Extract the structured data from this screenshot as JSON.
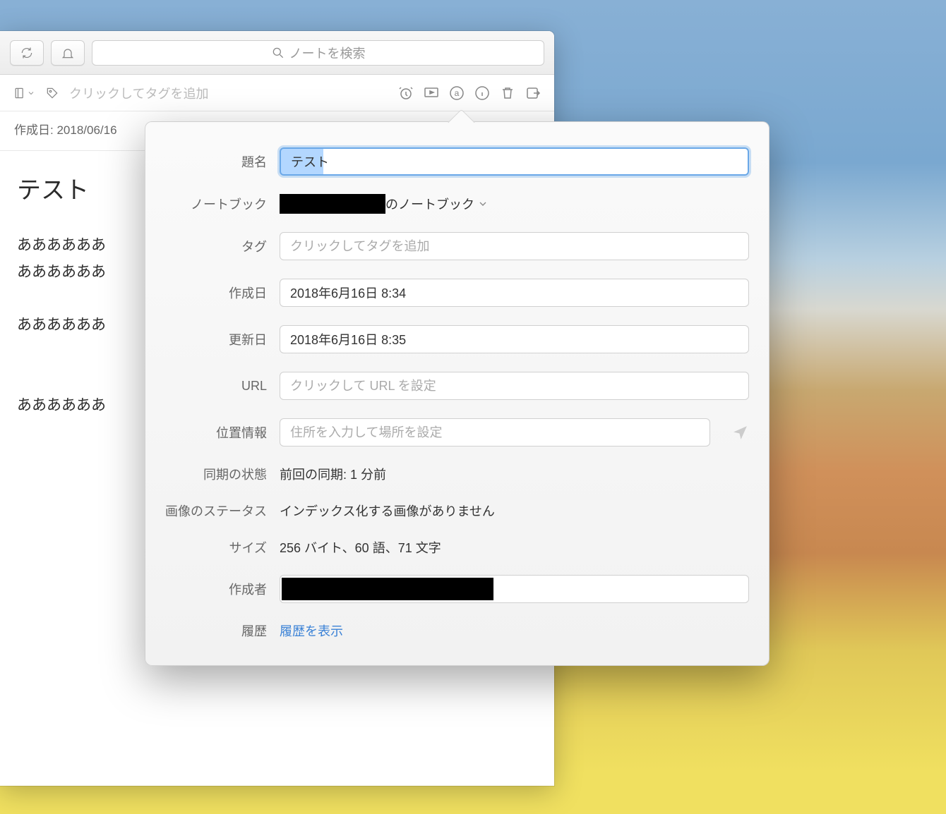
{
  "toolbar": {
    "search_placeholder": "ノートを検索"
  },
  "row2": {
    "tag_placeholder": "クリックしてタグを追加"
  },
  "meta": {
    "created_label": "作成日:",
    "created_value": "2018/06/16"
  },
  "note": {
    "title": "テスト",
    "lines": [
      "ああああああ",
      "ああああああ",
      "",
      "ああああああ",
      "",
      "",
      "ああああああ"
    ]
  },
  "popover": {
    "labels": {
      "title": "題名",
      "notebook": "ノートブック",
      "tag": "タグ",
      "created": "作成日",
      "updated": "更新日",
      "url": "URL",
      "location": "位置情報",
      "sync": "同期の状態",
      "image": "画像のステータス",
      "size": "サイズ",
      "author": "作成者",
      "history": "履歴"
    },
    "values": {
      "title": "テスト",
      "notebook_suffix": "のノートブック",
      "tag_placeholder": "クリックしてタグを追加",
      "created": "2018年6月16日 8:34",
      "updated": "2018年6月16日 8:35",
      "url_placeholder": "クリックして URL を設定",
      "location_placeholder": "住所を入力して場所を設定",
      "sync": "前回の同期: 1 分前",
      "image": "インデックス化する画像がありません",
      "size": "256 バイト、60 語、71 文字",
      "history_link": "履歴を表示"
    }
  }
}
